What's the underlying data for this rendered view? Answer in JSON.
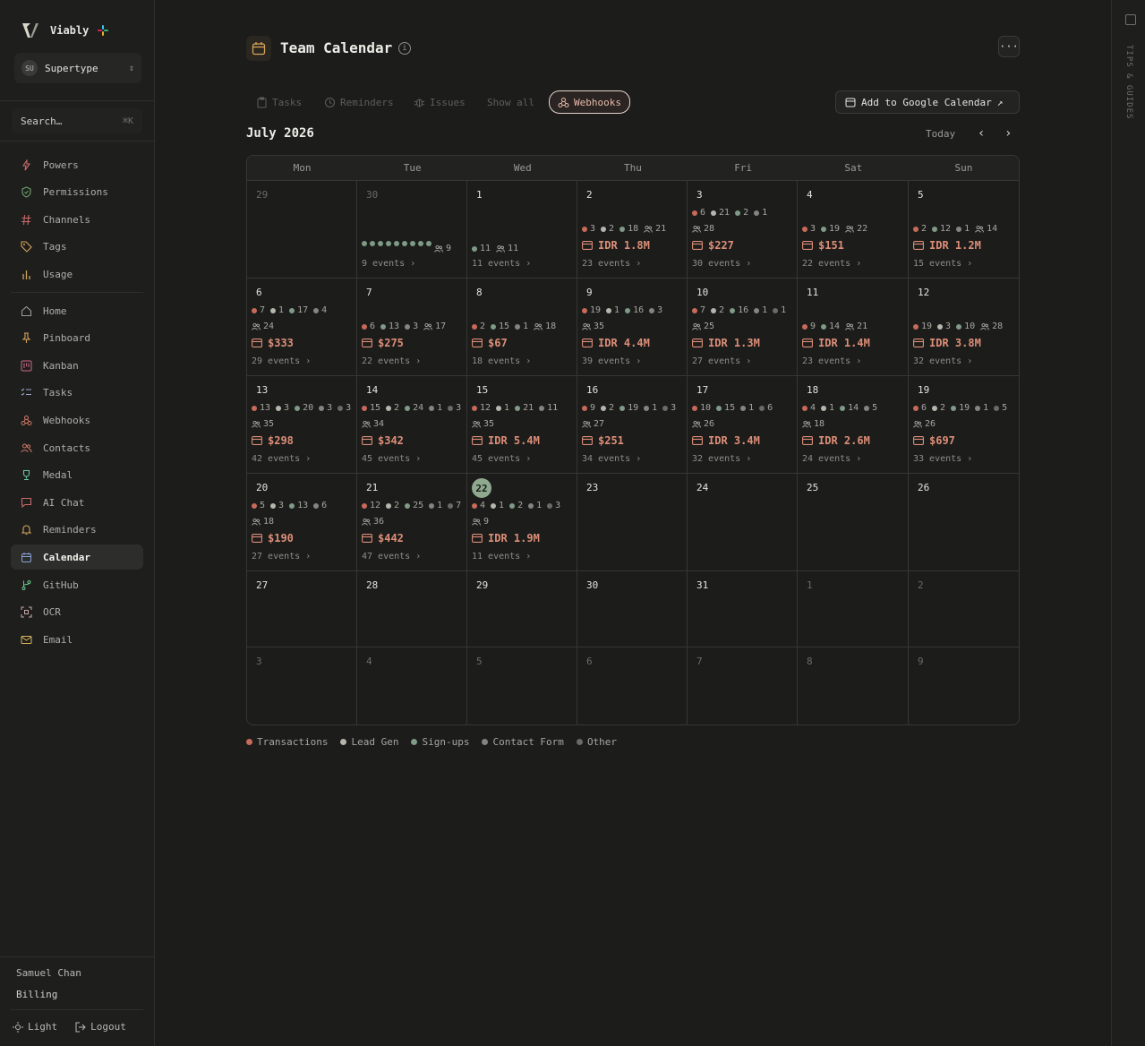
{
  "app": {
    "name": "Viably",
    "workspace_initials": "SU",
    "workspace_name": "Supertype"
  },
  "search": {
    "placeholder": "Search…",
    "shortcut": "⌘K"
  },
  "sidebar": {
    "group1": [
      {
        "label": "Powers",
        "icon": "bolt-icon"
      },
      {
        "label": "Permissions",
        "icon": "shield-icon"
      },
      {
        "label": "Channels",
        "icon": "hash-icon"
      },
      {
        "label": "Tags",
        "icon": "tag-icon"
      },
      {
        "label": "Usage",
        "icon": "bar-chart-icon"
      }
    ],
    "group2": [
      {
        "label": "Home",
        "icon": "home-icon"
      },
      {
        "label": "Pinboard",
        "icon": "pin-icon"
      },
      {
        "label": "Kanban",
        "icon": "kanban-icon"
      },
      {
        "label": "Tasks",
        "icon": "list-check-icon"
      },
      {
        "label": "Webhooks",
        "icon": "webhook-icon"
      },
      {
        "label": "Contacts",
        "icon": "users-icon"
      },
      {
        "label": "Medal",
        "icon": "trophy-icon"
      },
      {
        "label": "AI Chat",
        "icon": "chat-icon"
      },
      {
        "label": "Reminders",
        "icon": "bell-icon"
      },
      {
        "label": "Calendar",
        "icon": "calendar-icon",
        "active": true
      },
      {
        "label": "GitHub",
        "icon": "git-branch-icon"
      },
      {
        "label": "OCR",
        "icon": "scan-icon"
      },
      {
        "label": "Email",
        "icon": "mail-icon"
      }
    ],
    "user_name": "Samuel Chan",
    "billing_label": "Billing",
    "light_label": "Light",
    "logout_label": "Logout"
  },
  "rail": {
    "label": "TIPS & GUIDES"
  },
  "page": {
    "title": "Team Calendar",
    "filters": [
      {
        "label": "Tasks",
        "icon": "clipboard-icon"
      },
      {
        "label": "Reminders",
        "icon": "clock-icon"
      },
      {
        "label": "Issues",
        "icon": "bug-icon"
      },
      {
        "label": "Show all",
        "icon": ""
      },
      {
        "label": "Webhooks",
        "icon": "webhook-icon",
        "active": true
      }
    ],
    "gcal_label": "Add to Google Calendar",
    "month": "July 2026",
    "today_label": "Today",
    "weekdays": [
      "Mon",
      "Tue",
      "Wed",
      "Thu",
      "Fri",
      "Sat",
      "Sun"
    ]
  },
  "colors": {
    "transactions": "#c86a5a",
    "leadgen": "#b8b5ad",
    "signups": "#7f9a86",
    "contactform": "#858580",
    "other": "#6a6a66",
    "accent": "#dd8e78",
    "today": "#8fa98f"
  },
  "legend": [
    "Transactions",
    "Lead Gen",
    "Sign-ups",
    "Contact Form",
    "Other"
  ],
  "calendar": {
    "weeks": [
      [
        {
          "day": "29",
          "muted": true
        },
        {
          "day": "30",
          "muted": true,
          "dots": 9,
          "people": "9",
          "events": "9 events"
        },
        {
          "day": "1",
          "stats": [
            {
              "c": "signups",
              "n": "11"
            }
          ],
          "people": "11",
          "events": "11 events"
        },
        {
          "day": "2",
          "stats": [
            {
              "c": "transactions",
              "n": "3"
            },
            {
              "c": "leadgen",
              "n": "2"
            },
            {
              "c": "signups",
              "n": "18"
            }
          ],
          "people": "21",
          "amount": "IDR 1.8M",
          "events": "23 events"
        },
        {
          "day": "3",
          "stats": [
            {
              "c": "transactions",
              "n": "6"
            },
            {
              "c": "leadgen",
              "n": "21"
            },
            {
              "c": "signups",
              "n": "2"
            },
            {
              "c": "contactform",
              "n": "1"
            }
          ],
          "people": "28",
          "amount": "$227",
          "events": "30 events"
        },
        {
          "day": "4",
          "stats": [
            {
              "c": "transactions",
              "n": "3"
            },
            {
              "c": "signups",
              "n": "19"
            }
          ],
          "people": "22",
          "amount": "$151",
          "events": "22 events"
        },
        {
          "day": "5",
          "stats": [
            {
              "c": "transactions",
              "n": "2"
            },
            {
              "c": "signups",
              "n": "12"
            },
            {
              "c": "contactform",
              "n": "1"
            }
          ],
          "people": "14",
          "amount": "IDR 1.2M",
          "events": "15 events"
        }
      ],
      [
        {
          "day": "6",
          "stats": [
            {
              "c": "transactions",
              "n": "7"
            },
            {
              "c": "leadgen",
              "n": "1"
            },
            {
              "c": "signups",
              "n": "17"
            },
            {
              "c": "contactform",
              "n": "4"
            }
          ],
          "people": "24",
          "amount": "$333",
          "events": "29 events"
        },
        {
          "day": "7",
          "stats": [
            {
              "c": "transactions",
              "n": "6"
            },
            {
              "c": "signups",
              "n": "13"
            },
            {
              "c": "contactform",
              "n": "3"
            }
          ],
          "people": "17",
          "amount": "$275",
          "events": "22 events"
        },
        {
          "day": "8",
          "stats": [
            {
              "c": "transactions",
              "n": "2"
            },
            {
              "c": "signups",
              "n": "15"
            },
            {
              "c": "contactform",
              "n": "1"
            }
          ],
          "people": "18",
          "amount": "$67",
          "events": "18 events"
        },
        {
          "day": "9",
          "stats": [
            {
              "c": "transactions",
              "n": "19"
            },
            {
              "c": "leadgen",
              "n": "1"
            },
            {
              "c": "signups",
              "n": "16"
            },
            {
              "c": "contactform",
              "n": "3"
            }
          ],
          "people": "35",
          "amount": "IDR 4.4M",
          "events": "39 events"
        },
        {
          "day": "10",
          "stats": [
            {
              "c": "transactions",
              "n": "7"
            },
            {
              "c": "leadgen",
              "n": "2"
            },
            {
              "c": "signups",
              "n": "16"
            },
            {
              "c": "contactform",
              "n": "1"
            },
            {
              "c": "other",
              "n": "1"
            }
          ],
          "people": "25",
          "amount": "IDR 1.3M",
          "events": "27 events"
        },
        {
          "day": "11",
          "stats": [
            {
              "c": "transactions",
              "n": "9"
            },
            {
              "c": "signups",
              "n": "14"
            }
          ],
          "people": "21",
          "amount": "IDR 1.4M",
          "events": "23 events"
        },
        {
          "day": "12",
          "stats": [
            {
              "c": "transactions",
              "n": "19"
            },
            {
              "c": "leadgen",
              "n": "3"
            },
            {
              "c": "signups",
              "n": "10"
            }
          ],
          "people": "28",
          "amount": "IDR 3.8M",
          "events": "32 events"
        }
      ],
      [
        {
          "day": "13",
          "stats": [
            {
              "c": "transactions",
              "n": "13"
            },
            {
              "c": "leadgen",
              "n": "3"
            },
            {
              "c": "signups",
              "n": "20"
            },
            {
              "c": "contactform",
              "n": "3"
            },
            {
              "c": "other",
              "n": "3"
            }
          ],
          "people": "35",
          "amount": "$298",
          "events": "42 events"
        },
        {
          "day": "14",
          "stats": [
            {
              "c": "transactions",
              "n": "15"
            },
            {
              "c": "leadgen",
              "n": "2"
            },
            {
              "c": "signups",
              "n": "24"
            },
            {
              "c": "contactform",
              "n": "1"
            },
            {
              "c": "other",
              "n": "3"
            }
          ],
          "people": "34",
          "amount": "$342",
          "events": "45 events"
        },
        {
          "day": "15",
          "stats": [
            {
              "c": "transactions",
              "n": "12"
            },
            {
              "c": "leadgen",
              "n": "1"
            },
            {
              "c": "signups",
              "n": "21"
            },
            {
              "c": "contactform",
              "n": "11"
            }
          ],
          "people": "35",
          "amount": "IDR 5.4M",
          "events": "45 events"
        },
        {
          "day": "16",
          "stats": [
            {
              "c": "transactions",
              "n": "9"
            },
            {
              "c": "leadgen",
              "n": "2"
            },
            {
              "c": "signups",
              "n": "19"
            },
            {
              "c": "contactform",
              "n": "1"
            },
            {
              "c": "other",
              "n": "3"
            }
          ],
          "people": "27",
          "amount": "$251",
          "events": "34 events"
        },
        {
          "day": "17",
          "stats": [
            {
              "c": "transactions",
              "n": "10"
            },
            {
              "c": "signups",
              "n": "15"
            },
            {
              "c": "contactform",
              "n": "1"
            },
            {
              "c": "other",
              "n": "6"
            }
          ],
          "people": "26",
          "amount": "IDR 3.4M",
          "events": "32 events"
        },
        {
          "day": "18",
          "stats": [
            {
              "c": "transactions",
              "n": "4"
            },
            {
              "c": "leadgen",
              "n": "1"
            },
            {
              "c": "signups",
              "n": "14"
            },
            {
              "c": "contactform",
              "n": "5"
            }
          ],
          "people": "18",
          "amount": "IDR 2.6M",
          "events": "24 events"
        },
        {
          "day": "19",
          "stats": [
            {
              "c": "transactions",
              "n": "6"
            },
            {
              "c": "leadgen",
              "n": "2"
            },
            {
              "c": "signups",
              "n": "19"
            },
            {
              "c": "contactform",
              "n": "1"
            },
            {
              "c": "other",
              "n": "5"
            }
          ],
          "people": "26",
          "amount": "$697",
          "events": "33 events"
        }
      ],
      [
        {
          "day": "20",
          "stats": [
            {
              "c": "transactions",
              "n": "5"
            },
            {
              "c": "leadgen",
              "n": "3"
            },
            {
              "c": "signups",
              "n": "13"
            },
            {
              "c": "contactform",
              "n": "6"
            }
          ],
          "people": "18",
          "amount": "$190",
          "events": "27 events"
        },
        {
          "day": "21",
          "stats": [
            {
              "c": "transactions",
              "n": "12"
            },
            {
              "c": "leadgen",
              "n": "2"
            },
            {
              "c": "signups",
              "n": "25"
            },
            {
              "c": "contactform",
              "n": "1"
            },
            {
              "c": "other",
              "n": "7"
            }
          ],
          "people": "36",
          "amount": "$442",
          "events": "47 events"
        },
        {
          "day": "22",
          "today": true,
          "stats": [
            {
              "c": "transactions",
              "n": "4"
            },
            {
              "c": "leadgen",
              "n": "1"
            },
            {
              "c": "signups",
              "n": "2"
            },
            {
              "c": "contactform",
              "n": "1"
            },
            {
              "c": "other",
              "n": "3"
            }
          ],
          "people": "9",
          "amount": "IDR 1.9M",
          "events": "11 events"
        },
        {
          "day": "23"
        },
        {
          "day": "24"
        },
        {
          "day": "25"
        },
        {
          "day": "26"
        }
      ],
      [
        {
          "day": "27"
        },
        {
          "day": "28"
        },
        {
          "day": "29"
        },
        {
          "day": "30"
        },
        {
          "day": "31"
        },
        {
          "day": "1",
          "muted": true
        },
        {
          "day": "2",
          "muted": true
        }
      ],
      [
        {
          "day": "3",
          "muted": true
        },
        {
          "day": "4",
          "muted": true
        },
        {
          "day": "5",
          "muted": true
        },
        {
          "day": "6",
          "muted": true
        },
        {
          "day": "7",
          "muted": true
        },
        {
          "day": "8",
          "muted": true
        },
        {
          "day": "9",
          "muted": true
        }
      ]
    ]
  }
}
